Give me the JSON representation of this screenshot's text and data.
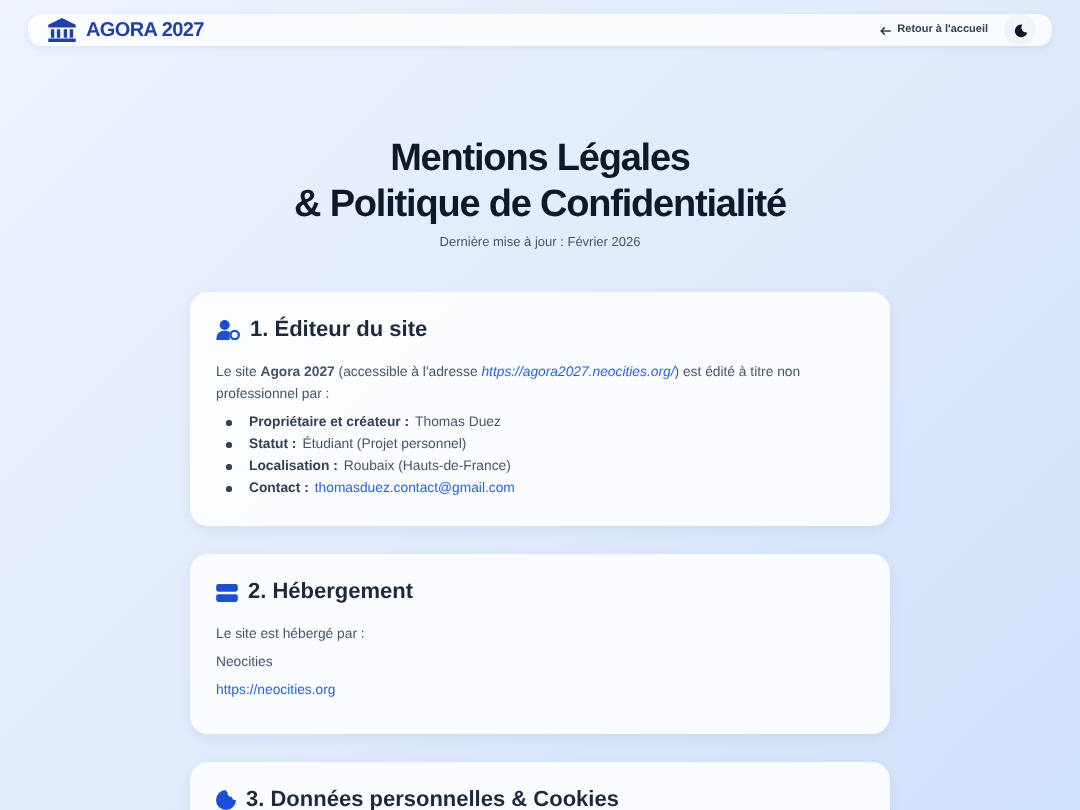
{
  "header": {
    "brand": "AGORA 2027",
    "back_link": "Retour à l'accueil"
  },
  "page": {
    "title_lines": [
      "Mentions Légales",
      "& Politique de Confidentialité"
    ],
    "updated": "Dernière mise à jour : Février 2026"
  },
  "sections": [
    {
      "title": "1. Éditeur du site",
      "blocks": [
        {
          "kind": "paragraph",
          "parts": [
            {
              "kind": "text",
              "text": "Le site **Agora 2027** (accessible à l'adresse "
            },
            {
              "kind": "link",
              "text": "https://agora2027.neocities.org/"
            },
            {
              "kind": "text",
              "text": ") est édité à titre non professionnel par :"
            }
          ]
        },
        {
          "kind": "list",
          "items": [
            {
              "label": "Propriétaire et créateur :",
              "value": "Thomas Duez",
              "kind": "text"
            },
            {
              "label": "Statut :",
              "value": "Étudiant (Projet personnel)",
              "kind": "text"
            },
            {
              "label": "Localisation :",
              "value": "Roubaix (Hauts-de-France)",
              "kind": "text"
            },
            {
              "label": "Contact :",
              "value": "thomasduez.contact@gmail.com",
              "kind": "email"
            }
          ]
        }
      ]
    },
    {
      "title": "2. Hébergement",
      "blocks": [
        {
          "kind": "paragraph",
          "parts": [
            {
              "kind": "text",
              "text": "Le site est hébergé par :"
            }
          ]
        },
        {
          "kind": "paragraph",
          "parts": [
            {
              "kind": "text",
              "text": "Neocities"
            }
          ]
        },
        {
          "kind": "paragraph",
          "parts": [
            {
              "kind": "link",
              "text": "https://neocities.org"
            }
          ]
        }
      ]
    },
    {
      "title": "3. Données personnelles & Cookies"
    }
  ]
}
